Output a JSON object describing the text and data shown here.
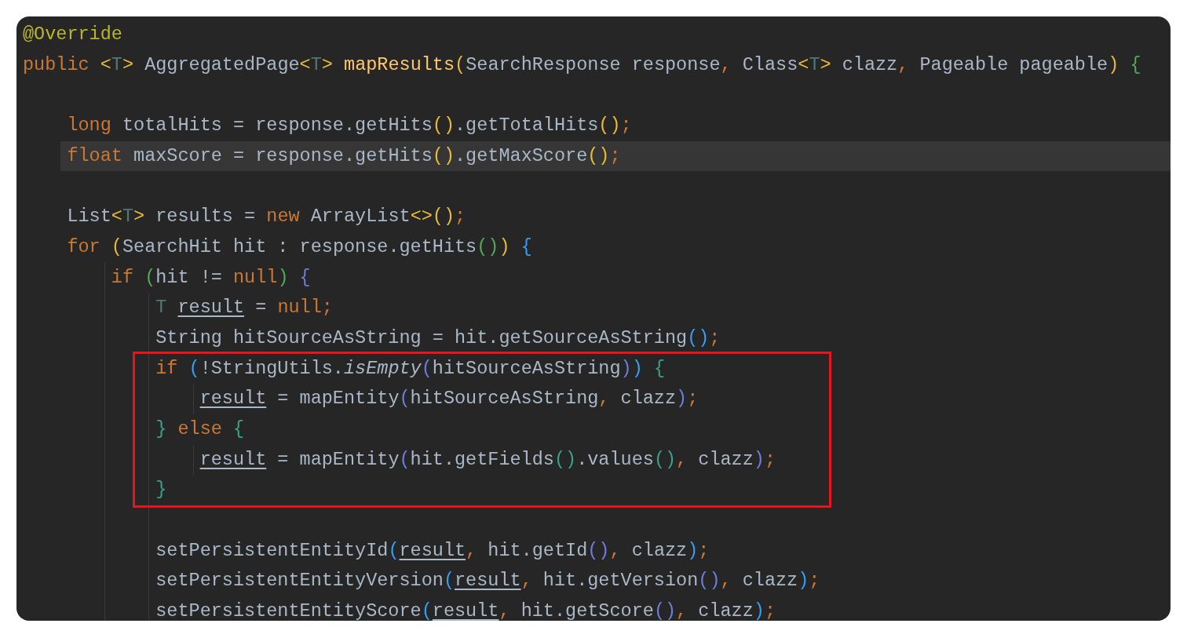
{
  "editor": {
    "lines": [
      {
        "kind": "code",
        "current": false,
        "tokens": [
          {
            "t": "@Override",
            "kind": "ann"
          }
        ]
      },
      {
        "kind": "code",
        "current": false,
        "tokens": [
          {
            "t": "public ",
            "kind": "kw"
          },
          {
            "t": "<",
            "kind": "y"
          },
          {
            "t": "T",
            "kind": "tp"
          },
          {
            "t": ">",
            "kind": "y"
          },
          {
            "t": " AggregatedPage",
            "kind": "id"
          },
          {
            "t": "<",
            "kind": "y"
          },
          {
            "t": "T",
            "kind": "tp"
          },
          {
            "t": "> ",
            "kind": "y"
          },
          {
            "t": "mapResults",
            "kind": "fn"
          },
          {
            "t": "(",
            "kind": "y"
          },
          {
            "t": "SearchResponse response",
            "kind": "id"
          },
          {
            "t": ",",
            "kind": "kw"
          },
          {
            "t": " Class",
            "kind": "id"
          },
          {
            "t": "<",
            "kind": "y"
          },
          {
            "t": "T",
            "kind": "tp"
          },
          {
            "t": ">",
            "kind": "y"
          },
          {
            "t": " clazz",
            "kind": "id"
          },
          {
            "t": ",",
            "kind": "kw"
          },
          {
            "t": " Pageable pageable",
            "kind": "id"
          },
          {
            "t": ") ",
            "kind": "y"
          },
          {
            "t": "{",
            "kind": "g"
          }
        ],
        "children": [
          {
            "kind": "blank"
          },
          {
            "kind": "code",
            "current": false,
            "tokens": [
              {
                "t": "long",
                "kind": "kw"
              },
              {
                "t": " totalHits = response.getHits",
                "kind": "id"
              },
              {
                "t": "()",
                "kind": "y"
              },
              {
                "t": ".getTotalHits",
                "kind": "id"
              },
              {
                "t": "()",
                "kind": "y"
              },
              {
                "t": ";",
                "kind": "kw"
              }
            ]
          },
          {
            "kind": "code",
            "current": true,
            "tokens": [
              {
                "t": "float",
                "kind": "kw"
              },
              {
                "t": " maxScore = response.getHits",
                "kind": "id"
              },
              {
                "t": "()",
                "kind": "y"
              },
              {
                "t": ".getMaxScore",
                "kind": "id"
              },
              {
                "t": "()",
                "kind": "y"
              },
              {
                "t": ";",
                "kind": "kw"
              }
            ]
          },
          {
            "kind": "blank"
          },
          {
            "kind": "code",
            "current": false,
            "tokens": [
              {
                "t": "List",
                "kind": "id"
              },
              {
                "t": "<",
                "kind": "y"
              },
              {
                "t": "T",
                "kind": "tp"
              },
              {
                "t": ">",
                "kind": "y"
              },
              {
                "t": " results = ",
                "kind": "id"
              },
              {
                "t": "new",
                "kind": "kw"
              },
              {
                "t": " ArrayList",
                "kind": "id"
              },
              {
                "t": "<>",
                "kind": "y"
              },
              {
                "t": "()",
                "kind": "y"
              },
              {
                "t": ";",
                "kind": "kw"
              }
            ]
          },
          {
            "kind": "code",
            "current": false,
            "tokens": [
              {
                "t": "for ",
                "kind": "kw"
              },
              {
                "t": "(",
                "kind": "y"
              },
              {
                "t": "SearchHit hit : response.getHits",
                "kind": "id"
              },
              {
                "t": "()",
                "kind": "g"
              },
              {
                "t": ") ",
                "kind": "y"
              },
              {
                "t": "{",
                "kind": "b"
              }
            ],
            "children": [
              {
                "kind": "code",
                "current": false,
                "tokens": [
                  {
                    "t": "if ",
                    "kind": "kw"
                  },
                  {
                    "t": "(",
                    "kind": "g"
                  },
                  {
                    "t": "hit != ",
                    "kind": "id"
                  },
                  {
                    "t": "null",
                    "kind": "kw"
                  },
                  {
                    "t": ") ",
                    "kind": "g"
                  },
                  {
                    "t": "{",
                    "kind": "p"
                  }
                ],
                "children": [
                  {
                    "kind": "code",
                    "current": false,
                    "tokens": [
                      {
                        "t": "T ",
                        "kind": "tp"
                      },
                      {
                        "t": "result",
                        "kind": "ul"
                      },
                      {
                        "t": " = ",
                        "kind": "id"
                      },
                      {
                        "t": "null",
                        "kind": "kw"
                      },
                      {
                        "t": ";",
                        "kind": "kw"
                      }
                    ]
                  },
                  {
                    "kind": "code",
                    "current": false,
                    "tokens": [
                      {
                        "t": "String hitSourceAsString = hit.getSourceAsString",
                        "kind": "id"
                      },
                      {
                        "t": "()",
                        "kind": "b"
                      },
                      {
                        "t": ";",
                        "kind": "kw"
                      }
                    ]
                  },
                  {
                    "kind": "group",
                    "boxed": true,
                    "children": [
                      {
                        "kind": "code",
                        "current": false,
                        "tokens": [
                          {
                            "t": "if ",
                            "kind": "kw"
                          },
                          {
                            "t": "(",
                            "kind": "b"
                          },
                          {
                            "t": "!StringUtils.",
                            "kind": "id"
                          },
                          {
                            "t": "isEmpty",
                            "kind": "it"
                          },
                          {
                            "t": "(",
                            "kind": "p"
                          },
                          {
                            "t": "hitSourceAsString",
                            "kind": "id"
                          },
                          {
                            "t": ")",
                            "kind": "p"
                          },
                          {
                            "t": ") ",
                            "kind": "b"
                          },
                          {
                            "t": "{",
                            "kind": "t"
                          }
                        ],
                        "children": [
                          {
                            "kind": "code",
                            "current": false,
                            "tokens": [
                              {
                                "t": "result",
                                "kind": "ul"
                              },
                              {
                                "t": " = mapEntity",
                                "kind": "id"
                              },
                              {
                                "t": "(",
                                "kind": "p"
                              },
                              {
                                "t": "hitSourceAsString",
                                "kind": "id"
                              },
                              {
                                "t": ",",
                                "kind": "kw"
                              },
                              {
                                "t": " clazz",
                                "kind": "id"
                              },
                              {
                                "t": ")",
                                "kind": "p"
                              },
                              {
                                "t": ";",
                                "kind": "kw"
                              }
                            ]
                          }
                        ]
                      },
                      {
                        "kind": "code",
                        "current": false,
                        "tokens": [
                          {
                            "t": "} ",
                            "kind": "t"
                          },
                          {
                            "t": "else ",
                            "kind": "kw"
                          },
                          {
                            "t": "{",
                            "kind": "t"
                          }
                        ],
                        "children": [
                          {
                            "kind": "code",
                            "current": false,
                            "tokens": [
                              {
                                "t": "result",
                                "kind": "ul"
                              },
                              {
                                "t": " = mapEntity",
                                "kind": "id"
                              },
                              {
                                "t": "(",
                                "kind": "p"
                              },
                              {
                                "t": "hit.getFields",
                                "kind": "id"
                              },
                              {
                                "t": "()",
                                "kind": "t"
                              },
                              {
                                "t": ".values",
                                "kind": "id"
                              },
                              {
                                "t": "()",
                                "kind": "t"
                              },
                              {
                                "t": ",",
                                "kind": "kw"
                              },
                              {
                                "t": " clazz",
                                "kind": "id"
                              },
                              {
                                "t": ")",
                                "kind": "p"
                              },
                              {
                                "t": ";",
                                "kind": "kw"
                              }
                            ]
                          }
                        ]
                      },
                      {
                        "kind": "code",
                        "current": false,
                        "tokens": [
                          {
                            "t": "}",
                            "kind": "t"
                          }
                        ]
                      }
                    ]
                  },
                  {
                    "kind": "blank"
                  },
                  {
                    "kind": "code",
                    "current": false,
                    "tokens": [
                      {
                        "t": "setPersistentEntityId",
                        "kind": "id"
                      },
                      {
                        "t": "(",
                        "kind": "b"
                      },
                      {
                        "t": "result",
                        "kind": "ul"
                      },
                      {
                        "t": ",",
                        "kind": "kw"
                      },
                      {
                        "t": " hit.getId",
                        "kind": "id"
                      },
                      {
                        "t": "()",
                        "kind": "p"
                      },
                      {
                        "t": ",",
                        "kind": "kw"
                      },
                      {
                        "t": " clazz",
                        "kind": "id"
                      },
                      {
                        "t": ")",
                        "kind": "b"
                      },
                      {
                        "t": ";",
                        "kind": "kw"
                      }
                    ]
                  },
                  {
                    "kind": "code",
                    "current": false,
                    "tokens": [
                      {
                        "t": "setPersistentEntityVersion",
                        "kind": "id"
                      },
                      {
                        "t": "(",
                        "kind": "b"
                      },
                      {
                        "t": "result",
                        "kind": "ul"
                      },
                      {
                        "t": ",",
                        "kind": "kw"
                      },
                      {
                        "t": " hit.getVersion",
                        "kind": "id"
                      },
                      {
                        "t": "()",
                        "kind": "p"
                      },
                      {
                        "t": ",",
                        "kind": "kw"
                      },
                      {
                        "t": " clazz",
                        "kind": "id"
                      },
                      {
                        "t": ")",
                        "kind": "b"
                      },
                      {
                        "t": ";",
                        "kind": "kw"
                      }
                    ]
                  },
                  {
                    "kind": "code",
                    "current": false,
                    "tokens": [
                      {
                        "t": "setPersistentEntityScore",
                        "kind": "id"
                      },
                      {
                        "t": "(",
                        "kind": "b"
                      },
                      {
                        "t": "result",
                        "kind": "ul"
                      },
                      {
                        "t": ",",
                        "kind": "kw"
                      },
                      {
                        "t": " hit.getScore",
                        "kind": "id"
                      },
                      {
                        "t": "()",
                        "kind": "p"
                      },
                      {
                        "t": ",",
                        "kind": "kw"
                      },
                      {
                        "t": " clazz",
                        "kind": "id"
                      },
                      {
                        "t": ")",
                        "kind": "b"
                      },
                      {
                        "t": ";",
                        "kind": "kw"
                      }
                    ]
                  }
                ]
              }
            ]
          }
        ]
      }
    ]
  }
}
